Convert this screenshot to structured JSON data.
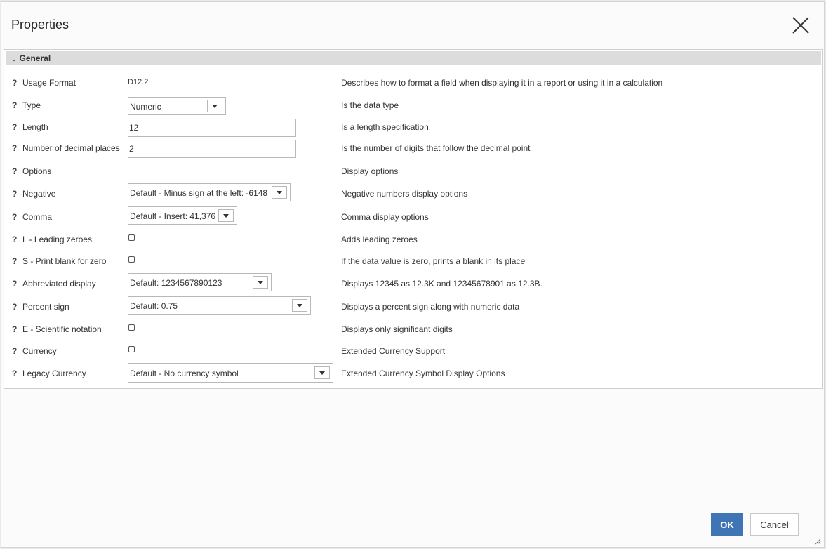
{
  "dialog": {
    "title": "Properties",
    "close_icon": "close-icon",
    "ok_label": "OK",
    "cancel_label": "Cancel",
    "accent_color": "#3f74b5"
  },
  "section": {
    "label": "General",
    "chevron_icon": "chevron-down-icon"
  },
  "properties": [
    {
      "label": "Usage Format",
      "value": "D12.2",
      "description": "Describes how to format a field when displaying it in a report or using it in a calculation"
    },
    {
      "label": "Type",
      "value": "Numeric",
      "description": "Is the data type"
    },
    {
      "label": "Length",
      "value": "12",
      "description": "Is a length specification"
    },
    {
      "label": "Number of decimal places",
      "value": "2",
      "description": "Is the number of digits that follow the decimal point"
    },
    {
      "label": "Options",
      "value": "",
      "description": "Display options"
    },
    {
      "label": "Negative",
      "value": "Default - Minus sign at the left: -6148",
      "description": "Negative numbers display options"
    },
    {
      "label": "Comma",
      "value": "Default - Insert: 41,376",
      "description": "Comma display options"
    },
    {
      "label": "L - Leading zeroes",
      "checked": false,
      "description": "Adds leading zeroes"
    },
    {
      "label": "S - Print blank for zero",
      "checked": false,
      "description": "If the data value is zero, prints a blank in its place"
    },
    {
      "label": "Abbreviated display",
      "value": "Default: 1234567890123",
      "description": "Displays 12345 as 12.3K and 12345678901 as 12.3B."
    },
    {
      "label": "Percent sign",
      "value": "Default: 0.75",
      "description": "Displays a percent sign along with numeric data"
    },
    {
      "label": "E - Scientific notation",
      "checked": false,
      "description": "Displays only significant digits"
    },
    {
      "label": "Currency",
      "checked": false,
      "description": "Extended Currency Support"
    },
    {
      "label": "Legacy Currency",
      "value": "Default - No currency symbol",
      "description": "Extended Currency Symbol Display Options"
    }
  ],
  "help_glyph": "?"
}
